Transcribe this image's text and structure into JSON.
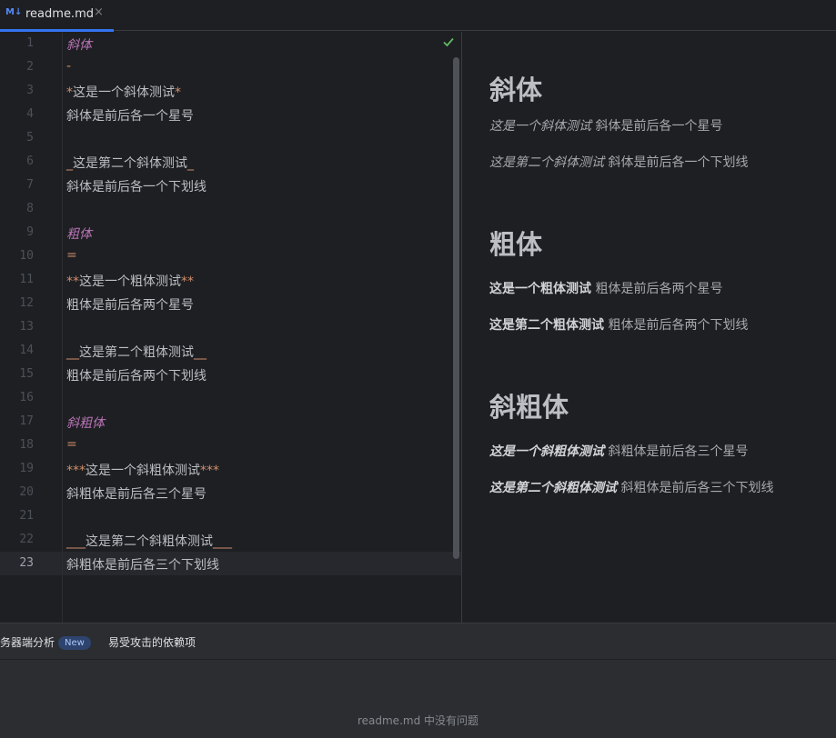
{
  "tab": {
    "icon": "M↓",
    "label": "readme.md",
    "close": "×"
  },
  "editor": {
    "current_line": 23,
    "lines": [
      {
        "n": "1",
        "segs": [
          {
            "t": "斜体",
            "c": "md-heading"
          }
        ]
      },
      {
        "n": "2",
        "segs": [
          {
            "t": "-",
            "c": "md-mark"
          }
        ]
      },
      {
        "n": "3",
        "segs": [
          {
            "t": "*",
            "c": "md-mark"
          },
          {
            "t": "这是一个斜体测试",
            "c": ""
          },
          {
            "t": "*",
            "c": "md-mark"
          }
        ]
      },
      {
        "n": "4",
        "segs": [
          {
            "t": "斜体是前后各一个星号",
            "c": ""
          }
        ]
      },
      {
        "n": "5",
        "segs": []
      },
      {
        "n": "6",
        "segs": [
          {
            "t": "_",
            "c": "md-mark"
          },
          {
            "t": "这是第二个斜体测试",
            "c": ""
          },
          {
            "t": "_",
            "c": "md-mark"
          }
        ]
      },
      {
        "n": "7",
        "segs": [
          {
            "t": "斜体是前后各一个下划线",
            "c": ""
          }
        ]
      },
      {
        "n": "8",
        "segs": []
      },
      {
        "n": "9",
        "segs": [
          {
            "t": "粗体",
            "c": "md-heading"
          }
        ]
      },
      {
        "n": "10",
        "segs": [
          {
            "t": "=",
            "c": "md-mark"
          }
        ]
      },
      {
        "n": "11",
        "segs": [
          {
            "t": "**",
            "c": "md-mark"
          },
          {
            "t": "这是一个粗体测试",
            "c": ""
          },
          {
            "t": "**",
            "c": "md-mark"
          }
        ]
      },
      {
        "n": "12",
        "segs": [
          {
            "t": "粗体是前后各两个星号",
            "c": ""
          }
        ]
      },
      {
        "n": "13",
        "segs": []
      },
      {
        "n": "14",
        "segs": [
          {
            "t": "__",
            "c": "md-mark"
          },
          {
            "t": "这是第二个粗体测试",
            "c": ""
          },
          {
            "t": "__",
            "c": "md-mark"
          }
        ]
      },
      {
        "n": "15",
        "segs": [
          {
            "t": "粗体是前后各两个下划线",
            "c": ""
          }
        ]
      },
      {
        "n": "16",
        "segs": []
      },
      {
        "n": "17",
        "segs": [
          {
            "t": "斜粗体",
            "c": "md-heading"
          }
        ]
      },
      {
        "n": "18",
        "segs": [
          {
            "t": "=",
            "c": "md-mark"
          }
        ]
      },
      {
        "n": "19",
        "segs": [
          {
            "t": "***",
            "c": "md-mark"
          },
          {
            "t": "这是一个斜粗体测试",
            "c": ""
          },
          {
            "t": "***",
            "c": "md-mark"
          }
        ]
      },
      {
        "n": "20",
        "segs": [
          {
            "t": "斜粗体是前后各三个星号",
            "c": ""
          }
        ]
      },
      {
        "n": "21",
        "segs": []
      },
      {
        "n": "22",
        "segs": [
          {
            "t": "___",
            "c": "md-mark"
          },
          {
            "t": "这是第二个斜粗体测试",
            "c": ""
          },
          {
            "t": "___",
            "c": "md-mark"
          }
        ]
      },
      {
        "n": "23",
        "segs": [
          {
            "t": "斜粗体是前后各三个下划线",
            "c": ""
          }
        ]
      }
    ]
  },
  "preview": {
    "blocks": [
      {
        "type": "h1",
        "text": "斜体"
      },
      {
        "type": "p",
        "segs": [
          {
            "t": "这是一个斜体测试",
            "s": "em"
          },
          {
            "t": " 斜体是前后各一个星号",
            "s": ""
          }
        ]
      },
      {
        "type": "p",
        "segs": [
          {
            "t": "这是第二个斜体测试",
            "s": "em"
          },
          {
            "t": " 斜体是前后各一个下划线",
            "s": ""
          }
        ]
      },
      {
        "type": "h1",
        "text": "粗体"
      },
      {
        "type": "p",
        "segs": [
          {
            "t": "这是一个粗体测试",
            "s": "strong"
          },
          {
            "t": " 粗体是前后各两个星号",
            "s": ""
          }
        ]
      },
      {
        "type": "p",
        "segs": [
          {
            "t": "这是第二个粗体测试",
            "s": "strong"
          },
          {
            "t": " 粗体是前后各两个下划线",
            "s": ""
          }
        ]
      },
      {
        "type": "h1",
        "text": "斜粗体"
      },
      {
        "type": "p",
        "segs": [
          {
            "t": "这是一个斜粗体测试",
            "s": "strong-em"
          },
          {
            "t": " 斜粗体是前后各三个星号",
            "s": ""
          }
        ]
      },
      {
        "type": "p",
        "segs": [
          {
            "t": "这是第二个斜粗体测试",
            "s": "strong-em"
          },
          {
            "t": " 斜粗体是前后各三个下划线",
            "s": ""
          }
        ]
      }
    ]
  },
  "bottom": {
    "tab1_label": "务器端分析",
    "tab1_badge": "New",
    "tab2_label": "易受攻击的依赖项",
    "status": "readme.md 中没有问题"
  }
}
